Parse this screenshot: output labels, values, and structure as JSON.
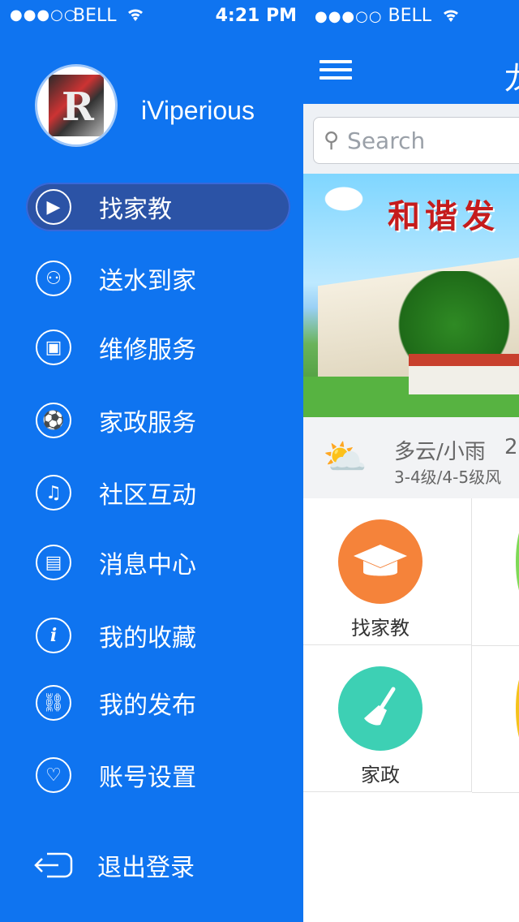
{
  "status_bar": {
    "signal": "●●●○○",
    "carrier": "BELL",
    "wifi_icon": "wifi-icon",
    "time": "4:21 PM"
  },
  "profile": {
    "username": "iViperious"
  },
  "menu": {
    "items": [
      {
        "label": "找家教",
        "icon": "video-camera-icon",
        "active": true
      },
      {
        "label": "送水到家",
        "icon": "film-reel-icon",
        "active": false
      },
      {
        "label": "维修服务",
        "icon": "tv-icon",
        "active": false
      },
      {
        "label": "家政服务",
        "icon": "soccer-ball-icon",
        "active": false
      },
      {
        "label": "社区互动",
        "icon": "music-note-icon",
        "active": false
      },
      {
        "label": "消息中心",
        "icon": "film-strip-icon",
        "active": false
      },
      {
        "label": "我的收藏",
        "icon": "info-icon",
        "active": false
      },
      {
        "label": "我的发布",
        "icon": "link-icon",
        "active": false
      },
      {
        "label": "账号设置",
        "icon": "heart-icon",
        "active": false
      }
    ],
    "logout_label": "退出登录"
  },
  "main": {
    "title_partial": "龙",
    "search_placeholder": "Search",
    "banner_slogan": "和谐发",
    "weather": {
      "condition": "多云/小雨",
      "temp_partial": "2",
      "wind": "3-4级/4-5级风"
    },
    "services": [
      {
        "label": "找家教",
        "icon": "graduation-cap-icon",
        "color": "#f5833a"
      },
      {
        "label": "家政",
        "icon": "broom-icon",
        "color": "#3dd0b4"
      }
    ]
  },
  "colors": {
    "accent": "#0f74f0",
    "active_item": "#2b53a6"
  }
}
